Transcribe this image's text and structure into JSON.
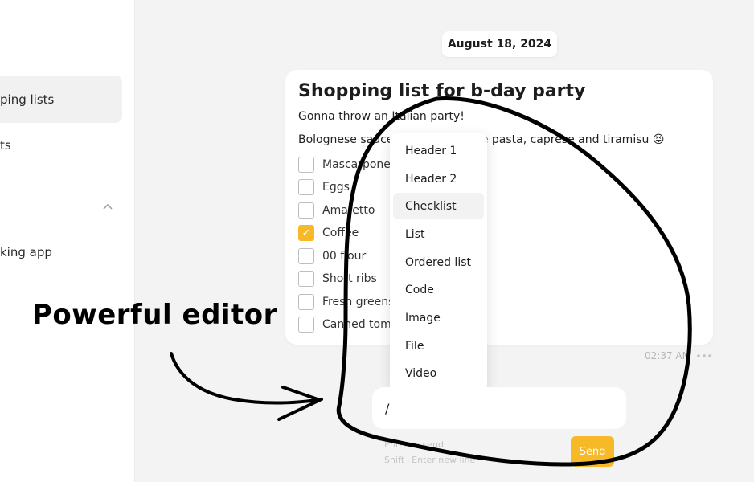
{
  "sidebar": {
    "items": [
      {
        "label": "ping lists",
        "active": true
      },
      {
        "label": "ts",
        "active": false
      },
      {
        "label": "king app",
        "active": false
      }
    ]
  },
  "date_pill": "August 18, 2024",
  "note": {
    "title": "Shopping list for b-day party",
    "line1": "Gonna throw an Italian party!",
    "line2": "Bolognese sauce with homemade pasta, caprese and tiramisu 😝",
    "checklist": [
      {
        "text": "Mascarpone",
        "checked": false
      },
      {
        "text": "Eggs",
        "checked": false
      },
      {
        "text": "Amaretto",
        "checked": false
      },
      {
        "text": "Coffee",
        "checked": true
      },
      {
        "text": "00 flour",
        "checked": false
      },
      {
        "text": "Short ribs",
        "checked": false
      },
      {
        "text": "Fresh greens",
        "checked": false
      },
      {
        "text": "Canned tomatoes",
        "checked": false
      }
    ],
    "timestamp": "02:37 AM",
    "check_glyph": "✓"
  },
  "slash_menu": {
    "items": [
      {
        "label": "Header 1",
        "active": false
      },
      {
        "label": "Header 2",
        "active": false
      },
      {
        "label": "Checklist",
        "active": true
      },
      {
        "label": "List",
        "active": false
      },
      {
        "label": "Ordered list",
        "active": false
      },
      {
        "label": "Code",
        "active": false
      },
      {
        "label": "Image",
        "active": false
      },
      {
        "label": "File",
        "active": false
      },
      {
        "label": "Video",
        "active": false
      }
    ]
  },
  "composer": {
    "value": "/",
    "hint_line1": "Enter to send",
    "hint_line2": "Shift+Enter new line",
    "send_label": "Send"
  },
  "annotation": {
    "label": "Powerful editor"
  },
  "colors": {
    "accent": "#f7b927",
    "background": "#f3f3f3",
    "card": "#ffffff"
  },
  "icons": {
    "chevron": "chevron-up-icon",
    "more": "more-horizontal-icon"
  }
}
